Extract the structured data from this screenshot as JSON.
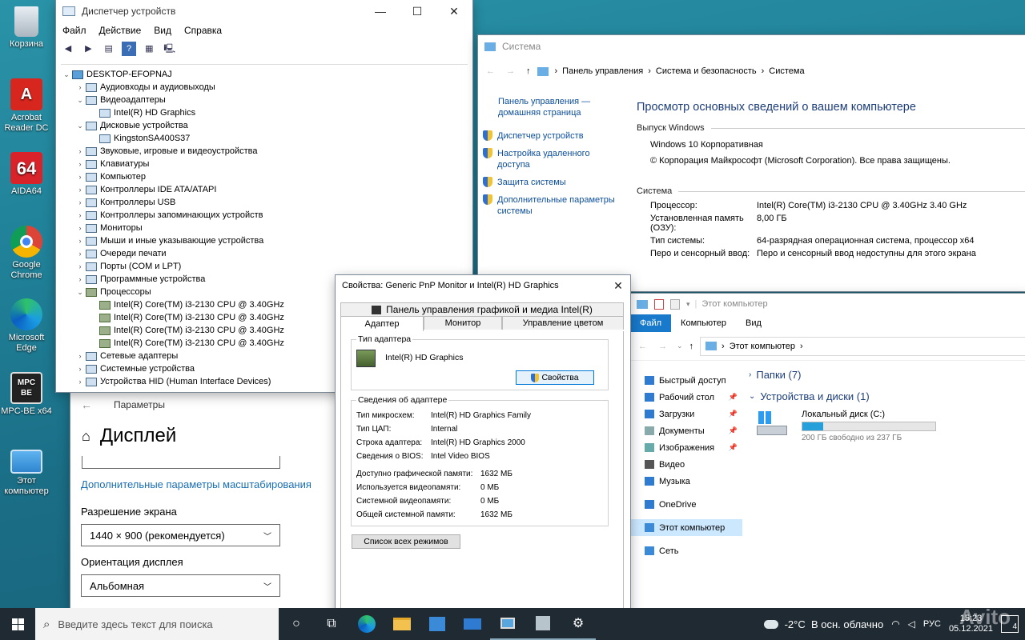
{
  "desktop": {
    "icons": [
      {
        "label": "Корзина"
      },
      {
        "label": "Acrobat Reader DC",
        "glyph": "A"
      },
      {
        "label": "AIDA64",
        "glyph": "64"
      },
      {
        "label": "Google Chrome"
      },
      {
        "label": "Microsoft Edge"
      },
      {
        "label": "MPC-BE x64",
        "glyph": "MPC BE"
      },
      {
        "label": "Этот компьютер"
      }
    ]
  },
  "devmgr": {
    "title": "Диспетчер устройств",
    "menu": [
      "Файл",
      "Действие",
      "Вид",
      "Справка"
    ],
    "tree": [
      {
        "label": "DESKTOP-EFOPNAJ",
        "level": 0,
        "arrow": "⌄"
      },
      {
        "label": "Аудиовходы и аудиовыходы",
        "level": 1,
        "arrow": "›"
      },
      {
        "label": "Видеоадаптеры",
        "level": 1,
        "arrow": "⌄"
      },
      {
        "label": "Intel(R) HD Graphics",
        "level": 2,
        "arrow": ""
      },
      {
        "label": "Дисковые устройства",
        "level": 1,
        "arrow": "⌄"
      },
      {
        "label": "KingstonSA400S37",
        "level": 2,
        "arrow": ""
      },
      {
        "label": "Звуковые, игровые и видеоустройства",
        "level": 1,
        "arrow": "›"
      },
      {
        "label": "Клавиатуры",
        "level": 1,
        "arrow": "›"
      },
      {
        "label": "Компьютер",
        "level": 1,
        "arrow": "›"
      },
      {
        "label": "Контроллеры IDE ATA/ATAPI",
        "level": 1,
        "arrow": "›"
      },
      {
        "label": "Контроллеры USB",
        "level": 1,
        "arrow": "›"
      },
      {
        "label": "Контроллеры запоминающих устройств",
        "level": 1,
        "arrow": "›"
      },
      {
        "label": "Мониторы",
        "level": 1,
        "arrow": "›"
      },
      {
        "label": "Мыши и иные указывающие устройства",
        "level": 1,
        "arrow": "›"
      },
      {
        "label": "Очереди печати",
        "level": 1,
        "arrow": "›"
      },
      {
        "label": "Порты (COM и LPT)",
        "level": 1,
        "arrow": "›"
      },
      {
        "label": "Программные устройства",
        "level": 1,
        "arrow": "›"
      },
      {
        "label": "Процессоры",
        "level": 1,
        "arrow": "⌄"
      },
      {
        "label": "Intel(R) Core(TM) i3-2130 CPU @ 3.40GHz",
        "level": 2,
        "arrow": ""
      },
      {
        "label": "Intel(R) Core(TM) i3-2130 CPU @ 3.40GHz",
        "level": 2,
        "arrow": ""
      },
      {
        "label": "Intel(R) Core(TM) i3-2130 CPU @ 3.40GHz",
        "level": 2,
        "arrow": ""
      },
      {
        "label": "Intel(R) Core(TM) i3-2130 CPU @ 3.40GHz",
        "level": 2,
        "arrow": ""
      },
      {
        "label": "Сетевые адаптеры",
        "level": 1,
        "arrow": "›"
      },
      {
        "label": "Системные устройства",
        "level": 1,
        "arrow": "›"
      },
      {
        "label": "Устройства HID (Human Interface Devices)",
        "level": 1,
        "arrow": "›"
      }
    ]
  },
  "system": {
    "title": "Система",
    "breadcrumb": [
      "Панель управления",
      "Система и безопасность",
      "Система"
    ],
    "home_link": "Панель управления — домашняя страница",
    "side_links": [
      "Диспетчер устройств",
      "Настройка удаленного доступа",
      "Защита системы",
      "Дополнительные параметры системы"
    ],
    "heading": "Просмотр основных сведений о вашем компьютере",
    "edition_section": "Выпуск Windows",
    "edition": "Windows 10 Корпоративная",
    "copyright": "© Корпорация Майкрософт (Microsoft Corporation). Все права защищены.",
    "system_section": "Система",
    "rows": [
      {
        "k": "Процессор:",
        "v": "Intel(R) Core(TM) i3-2130 CPU @ 3.40GHz   3.40 GHz"
      },
      {
        "k": "Установленная память (ОЗУ):",
        "v": "8,00 ГБ"
      },
      {
        "k": "Тип системы:",
        "v": "64-разрядная операционная система, процессор x64"
      },
      {
        "k": "Перо и сенсорный ввод:",
        "v": "Перо и сенсорный ввод недоступны для этого экрана"
      }
    ]
  },
  "props": {
    "title": "Свойства: Generic PnP Monitor и Intel(R) HD Graphics",
    "top_tab": "Панель управления графикой и медиа Intel(R)",
    "tabs": [
      "Адаптер",
      "Монитор",
      "Управление цветом"
    ],
    "adapter_type_label": "Тип адаптера",
    "adapter_name": "Intel(R) HD Graphics",
    "props_button": "Свойства",
    "info_label": "Сведения об адаптере",
    "info": [
      {
        "k": "Тип микросхем:",
        "v": "Intel(R) HD Graphics Family"
      },
      {
        "k": "Тип ЦАП:",
        "v": "Internal"
      },
      {
        "k": "Строка адаптера:",
        "v": "Intel(R) HD Graphics 2000"
      },
      {
        "k": "Сведения о BIOS:",
        "v": "Intel Video BIOS"
      }
    ],
    "mem": [
      {
        "k": "Доступно графической памяти:",
        "v": "1632 МБ"
      },
      {
        "k": "Используется видеопамяти:",
        "v": "0 МБ"
      },
      {
        "k": "Системной видеопамяти:",
        "v": "0 МБ"
      },
      {
        "k": "Общей системной памяти:",
        "v": "1632 МБ"
      }
    ],
    "modes_button": "Список всех режимов"
  },
  "settings": {
    "title": "Параметры",
    "heading": "Дисплей",
    "scale_link": "Дополнительные параметры масштабирования",
    "resolution_label": "Разрешение экрана",
    "resolution_value": "1440 × 900 (рекомендуется)",
    "orientation_label": "Ориентация дисплея",
    "orientation_value": "Альбомная"
  },
  "explorer": {
    "title": "Этот компьютер",
    "ribbon": [
      "Файл",
      "Компьютер",
      "Вид"
    ],
    "address": "Этот компьютер",
    "nav": [
      {
        "label": "Быстрый доступ",
        "pin": false,
        "color": "#2f7bd1"
      },
      {
        "label": "Рабочий стол",
        "pin": true,
        "color": "#2f7bd1"
      },
      {
        "label": "Загрузки",
        "pin": true,
        "color": "#2f7bd1"
      },
      {
        "label": "Документы",
        "pin": true,
        "color": "#8aa"
      },
      {
        "label": "Изображения",
        "pin": true,
        "color": "#6aa"
      },
      {
        "label": "Видео",
        "pin": false,
        "color": "#555"
      },
      {
        "label": "Музыка",
        "pin": false,
        "color": "#2f7bd1"
      },
      {
        "label": "OneDrive",
        "pin": false,
        "color": "#2f7bd1"
      },
      {
        "label": "Этот компьютер",
        "pin": false,
        "color": "#3a8ad8"
      },
      {
        "label": "Сеть",
        "pin": false,
        "color": "#3a8ad8"
      }
    ],
    "folders": "Папки (7)",
    "devices": "Устройства и диски (1)",
    "disk_name": "Локальный диск (C:)",
    "disk_free": "200 ГБ свободно из 237 ГБ",
    "disk_used_fraction": 0.156
  },
  "taskbar": {
    "search_placeholder": "Введите здесь текст для поиска",
    "weather": "-2°C  В осн. облачно",
    "lang": "РУС",
    "time": "15:23",
    "date": "05.12.2021",
    "notifications": "4"
  },
  "watermark": "Avito",
  "colors": {
    "accent": "#0078d7",
    "link": "#0b4e9b",
    "taskbar": "#1f2a33"
  }
}
